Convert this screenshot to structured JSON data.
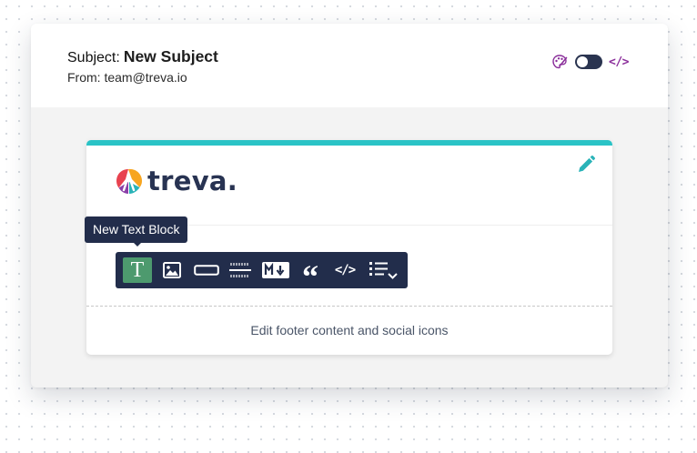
{
  "header": {
    "subject_label": "Subject:",
    "subject_value": "New Subject",
    "from_text": "From: team@treva.io",
    "code_view_label": "</>"
  },
  "email": {
    "logo_text": "treva.",
    "footer_text": "Edit footer content and social icons"
  },
  "toolbar": {
    "tooltip": "New Text Block",
    "text_block_glyph": "T",
    "quote_glyph": "“",
    "code_glyph": "</>",
    "items": [
      "text-block",
      "image-block",
      "button-block",
      "divider-block",
      "markdown-block",
      "quote-block",
      "code-block",
      "list-block"
    ]
  },
  "colors": {
    "accent_bar": "#2ac3c6",
    "toolbar_bg": "#222d4b",
    "active_tool": "#4d9a6e",
    "code_toggle": "#8a2d9a",
    "logo_text": "#283352"
  },
  "toggle_state": "off"
}
